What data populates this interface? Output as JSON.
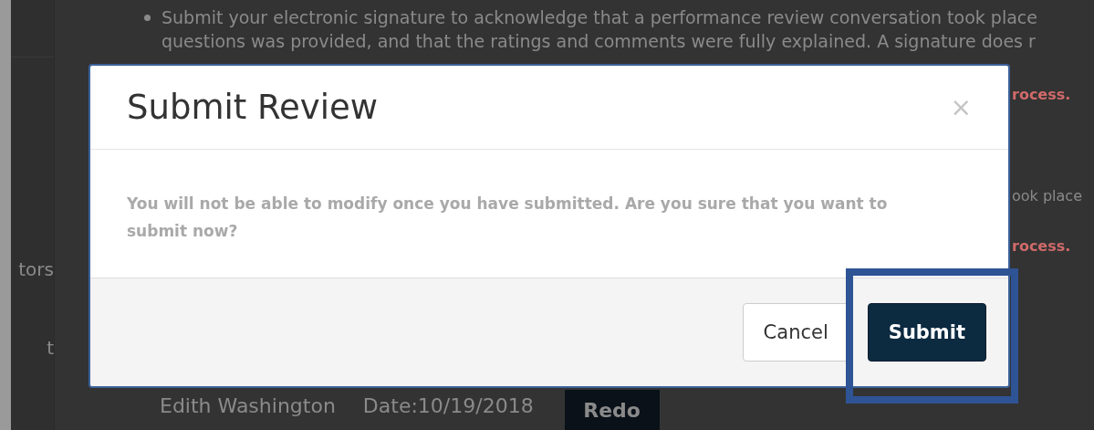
{
  "background_page": {
    "bullets": [
      "Submit your electronic signature to acknowledge that a performance review conversation took place"
    ],
    "bullet_continuation": "questions was provided, and that the ratings and comments were fully explained. A signature does r",
    "sidebar_items": [
      "tors",
      "t"
    ],
    "right_fragments": [
      {
        "text": "rocess.",
        "kind": "warning"
      },
      {
        "text": "ook place",
        "kind": "normal"
      },
      {
        "text": "rocess.",
        "kind": "warning"
      }
    ],
    "signature": {
      "name": "Edith Washington",
      "date": "Date:10/19/2018",
      "button": "Redo"
    }
  },
  "dialog": {
    "title": "Submit Review",
    "close": "×",
    "message": "You will not be able to modify once you have submitted. Are you sure that you want to submit now?",
    "buttons": [
      {
        "label": "Cancel",
        "kind": "secondary",
        "highlighted": false
      },
      {
        "label": "Submit",
        "kind": "primary",
        "highlighted": true
      }
    ]
  }
}
